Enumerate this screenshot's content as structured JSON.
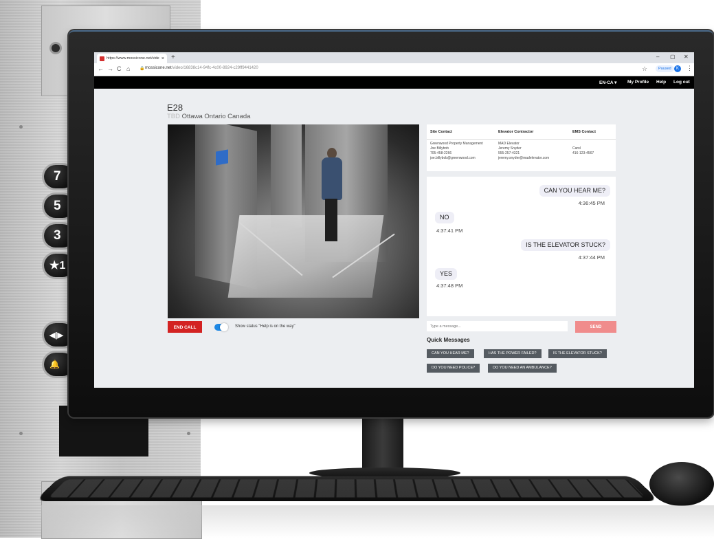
{
  "browser": {
    "tab_title": "https://www.mossicone.net/vide",
    "tab_close": "×",
    "new_tab": "+",
    "window_controls": [
      "–",
      "▢",
      "✕"
    ],
    "nav": [
      "←",
      "→",
      "C",
      "⌂"
    ],
    "url_host": "mossicone.net",
    "url_path": "/video/16838c14-94fc-4c00-8924-c29ff9441420",
    "paused_label": "Paused",
    "avatar_initial": "K"
  },
  "header": {
    "language": "EN-CA ▾",
    "my_profile": "My Profile",
    "help": "Help",
    "logout": "Log out"
  },
  "car": {
    "id": "E28",
    "tbd": "TBD",
    "location": "Ottawa Ontario Canada"
  },
  "controls": {
    "end_call": "END CALL",
    "status_toggle_label": "Show status \"Help is on the way\""
  },
  "contacts": {
    "site": {
      "heading": "Site Contact",
      "lines": [
        "Greenwood Property Management",
        "Joe Billybob",
        "705-458-2266",
        "joe.billybob@greenwood.com"
      ]
    },
    "elevator": {
      "heading": "Elevator Contractor",
      "lines": [
        "MAD Elevator",
        "Jeremy Snyder",
        "555-257-4321",
        "jeremy.snyder@madelevator.com"
      ]
    },
    "ems": {
      "heading": "EMS Contact",
      "lines": [
        "Carol",
        "416-123-4567"
      ]
    }
  },
  "chat": {
    "messages": [
      {
        "text": "CAN YOU HEAR ME?",
        "time": "4:36:45 PM",
        "side": "right"
      },
      {
        "text": "NO",
        "time": "4:37:41 PM",
        "side": "left"
      },
      {
        "text": "IS THE ELEVATOR STUCK?",
        "time": "4:37:44 PM",
        "side": "right"
      },
      {
        "text": "YES",
        "time": "4:37:48 PM",
        "side": "left"
      }
    ],
    "input_placeholder": "Type a message...",
    "send_label": "SEND"
  },
  "quick_messages": {
    "title": "Quick Messages",
    "items": [
      "CAN YOU HEAR ME?",
      "HAS THE POWER FAILED?",
      "IS THE ELEVATOR STUCK?",
      "DO YOU NEED POLICE?",
      "DO YOU NEED AN AMBULANCE?"
    ]
  },
  "elevator_panel": {
    "buttons": [
      "7",
      "5",
      "3",
      "★1",
      "◀|▶",
      "🔔"
    ]
  },
  "colors": {
    "end_call": "#d32222",
    "send": "#f08c8c",
    "toggle": "#1e88e5",
    "quick_message": "#555b61",
    "header": "#000000"
  }
}
